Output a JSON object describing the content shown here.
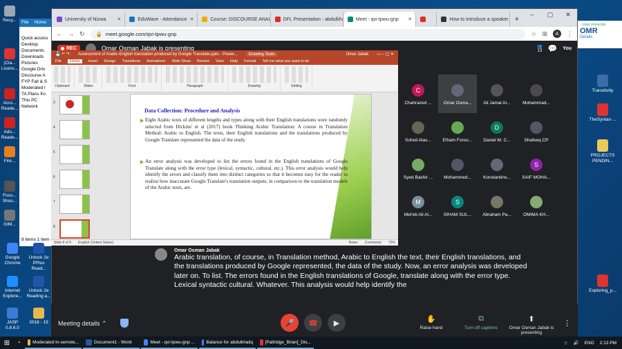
{
  "desktop_left": [
    {
      "label": "Recy...",
      "color": "#9aa7b4"
    },
    {
      "label": "(Cla... Licens...",
      "color": "#d33"
    },
    {
      "label": "Acro... Reade...",
      "color": "#c22"
    },
    {
      "label": "Ado... Reade...",
      "color": "#c22"
    },
    {
      "label": "Fire...",
      "color": "#e67e22"
    },
    {
      "label": "Focu... Shoo...",
      "color": "#555"
    },
    {
      "label": "GIM...",
      "color": "#777"
    },
    {
      "label": "Google Chrome",
      "color": "#4285f4"
    },
    {
      "label": "Unlock 2e PPlus Read...",
      "color": "#2255aa"
    },
    {
      "label": "Internet Explore...",
      "color": "#1e90ff"
    },
    {
      "label": "Unlock 2e Reading a...",
      "color": "#2255aa"
    },
    {
      "label": "JASP 0.8.6.0",
      "color": "#3a7bd5"
    },
    {
      "label": "2016 - 19",
      "color": "#e8b94a"
    }
  ],
  "desktop_right": [
    {
      "label": "Transitivity",
      "color": "#3a6ea5"
    },
    {
      "label": "TheSyntax-...",
      "color": "#d33"
    },
    {
      "label": "PROJECTS PENDIN...",
      "color": "#e8c95a"
    },
    {
      "label": "Exploring_p...",
      "color": "#d33"
    }
  ],
  "explorer": {
    "items": [
      "Quick access",
      "Desktop",
      "Documents",
      "Downloads",
      "Pictures",
      "Google Driv",
      "Discourse A",
      "FYP Fall & S",
      "Moderated I",
      "TA Plans fro",
      "This PC",
      "Network"
    ],
    "footer": "8 items    1 item s"
  },
  "browser": {
    "tabs": [
      {
        "label": "University of Nizwa",
        "color": "#7a4bc2"
      },
      {
        "label": "EduWave - Attendance",
        "color": "#1b75bc"
      },
      {
        "label": "Course: DISCOURSE ANALYSIS",
        "color": "#f2a900"
      },
      {
        "label": "DFL Presentation - abdulkhaliq...",
        "color": "#d93025"
      },
      {
        "label": "Meet - qvi-tpwu-gnp",
        "color": "#00897b"
      },
      {
        "label": "",
        "color": "#d93025"
      },
      {
        "label": "How to introduce a speaker —...",
        "color": "#333"
      }
    ],
    "url": "meet.google.com/qvi-tpwu-gnp",
    "profile_letter": "A"
  },
  "meet": {
    "rec_label": "REC",
    "presenting_title": "Omar Osman Jabak is presenting",
    "people_count": "13",
    "you_label": "You",
    "nizwa_badge": "OMR",
    "nizwa_details": "Details",
    "participants": [
      {
        "name": "Chahrazed ...",
        "initial": "C",
        "color": "#c2185b"
      },
      {
        "name": "Omar Osma...",
        "initial": "",
        "color": "#667"
      },
      {
        "name": "Ali Jamal Ar...",
        "initial": "",
        "color": "#555"
      },
      {
        "name": "Mohammad...",
        "initial": "",
        "color": "#4a4a4a"
      },
      {
        "name": "Soheil Atas...",
        "initial": "",
        "color": "#665"
      },
      {
        "name": "Elham Foroo...",
        "initial": "",
        "color": "#6a5"
      },
      {
        "name": "Daniel M. C...",
        "initial": "D",
        "color": "#0b7a5c"
      },
      {
        "name": "Shafeeq CP",
        "initial": "",
        "color": "#556"
      },
      {
        "name": "Syed Bashir ...",
        "initial": "",
        "color": "#7a6"
      },
      {
        "name": "Mohammed...",
        "initial": "",
        "color": "#556"
      },
      {
        "name": "Konstantino...",
        "initial": "",
        "color": "#667"
      },
      {
        "name": "SAIF MOHA...",
        "initial": "S",
        "color": "#8e24aa"
      },
      {
        "name": "Met'eb Ali Al...",
        "initial": "M",
        "color": "#78909c"
      },
      {
        "name": "SIHAM SUL...",
        "initial": "S",
        "color": "#00897b"
      },
      {
        "name": "Abraham Pa...",
        "initial": "",
        "color": "#776"
      },
      {
        "name": "OMIMA KH...",
        "initial": "",
        "color": "#8a7"
      }
    ],
    "caption_speaker": "Omar Osman Jabak",
    "caption_text": "Arabic translation, of course, in Translation method, Arabic to English the text, their English translations, and the translations produced by Google represented, the data of the study. Now, an error analysis was developed later on. To list. The errors found in the English translations of Google, translate along with the error type. Lexical syntactic cultural. Whatever. This analysis would help identify the",
    "meeting_details": "Meeting details",
    "raise_hand": "Raise hand",
    "turn_off_captions": "Turn off captions",
    "presenting_short": "Omar Osman Jabak is presenting"
  },
  "ppt": {
    "window_title": "Assessment of Arabic-English translation produced by Google Translate.pptx - Power...",
    "drawing_tools": "Drawing Tools",
    "user": "Omar Jabak",
    "tabs": [
      "File",
      "Home",
      "Insert",
      "Design",
      "Transitions",
      "Animations",
      "Slide Show",
      "Review",
      "View",
      "Help",
      "Format",
      "Tell me what you want to do"
    ],
    "ribbon_groups": [
      "Clipboard",
      "Slides",
      "Font",
      "Paragraph",
      "Drawing",
      "Editing"
    ],
    "slide_title": "Data Collection: Procedure and Analysis",
    "bullet1": "Eight Arabic texts of different lengths and types along with their English translations were randomly selected from Dickins' et al (2017) book Thinking Arabic Translation: A course in Translation Method: Arabic to English. The texts, their English translations and the translations produced by Google Translate represented the data of the study.",
    "bullet2": "An error analysis was developed to list the errors found in the English translations of Google Translate along with the error type (lexical, syntactic, cultural, etc.). This error analysis would help identify the errors and classify them into distinct categories so that it becomes easy for the reader to realize how inaccurate Google Translate's translation outputs, in comparison to the translation models of the Arabic texts, are.",
    "thumb_numbers": [
      "3",
      "4",
      "5",
      "6",
      "7",
      "8"
    ],
    "status_slide": "Slide 8 of 9",
    "status_lang": "English (United States)",
    "status_notes": "Notes",
    "status_comments": "Comments",
    "status_zoom": "73%"
  },
  "taskbar": {
    "items": [
      {
        "label": "Moderated In-semste...",
        "color": "#e8b94a"
      },
      {
        "label": "Document1 - Word",
        "color": "#2b579a"
      },
      {
        "label": "Meet - qvi-tpwu-gnp ...",
        "color": "#4285f4"
      },
      {
        "label": "Balance for abdulkhaliq",
        "color": "#4285f4"
      },
      {
        "label": "[Paltridge_Brian]_Dis...",
        "color": "#d33"
      }
    ],
    "lang": "ENG",
    "time": "2:13 PM"
  }
}
